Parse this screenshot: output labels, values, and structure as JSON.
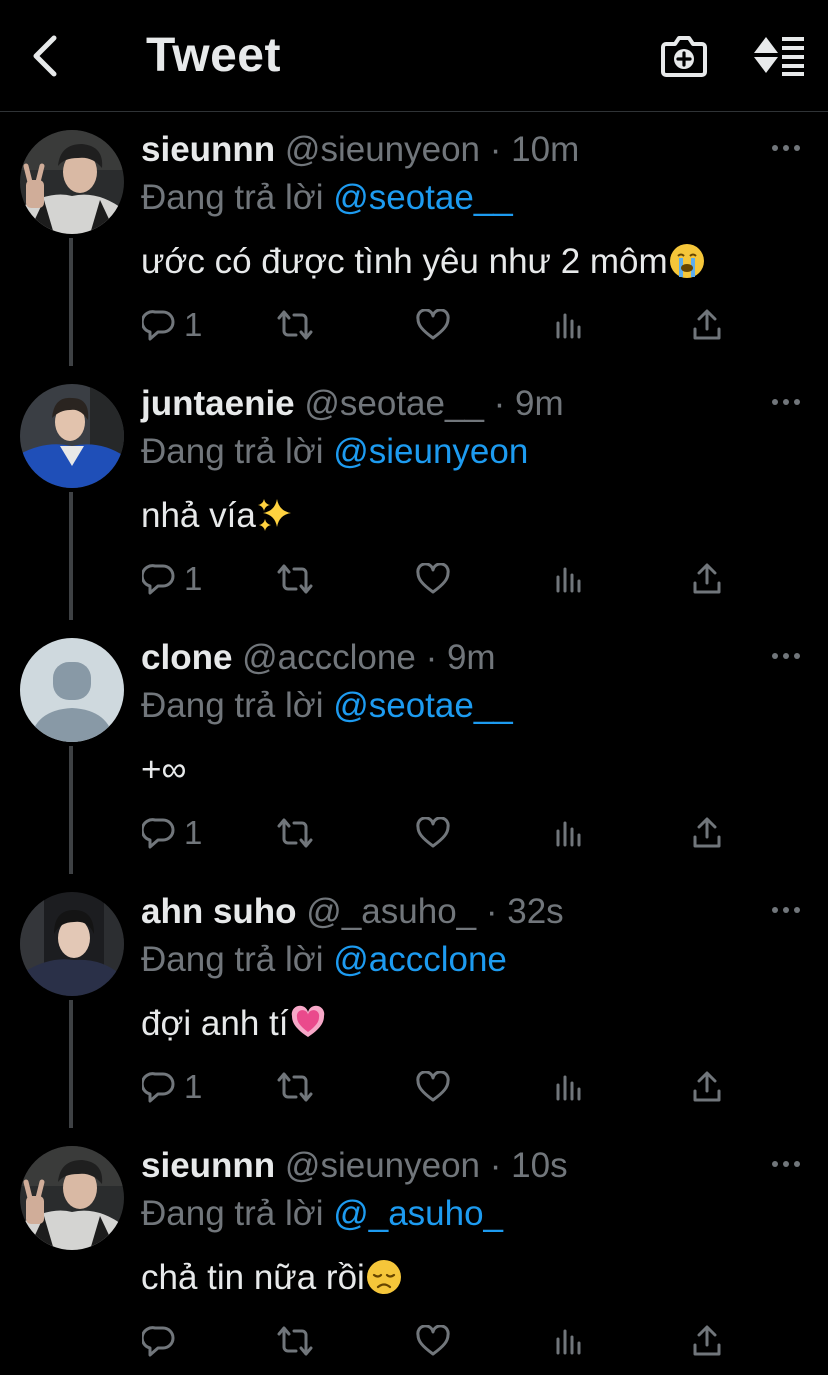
{
  "header": {
    "title": "Tweet",
    "back_icon": "chevron-left-icon",
    "camera_icon": "camera-add-icon",
    "sort_icon": "sort-icon"
  },
  "colors": {
    "background": "#000000",
    "text": "#e7e9ea",
    "muted": "#71767b",
    "mention": "#1d9bf0",
    "divider": "#2f3336",
    "thread": "#3e4144"
  },
  "reply_prefix": "Đang trả lời",
  "tweets": [
    {
      "name": "sieunnn",
      "handle": "@sieunyeon",
      "dot": "·",
      "time": "10m",
      "reply_to": "@seotae__",
      "text": "ước có được tình yêu như 2 môm",
      "emoji": "loudly-crying-face",
      "reply_count": "1",
      "avatar": "photo"
    },
    {
      "name": "juntaenie",
      "handle": "@seotae__",
      "dot": "·",
      "time": "9m",
      "reply_to": "@sieunyeon",
      "text": "nhả vía",
      "emoji": "sparkles",
      "reply_count": "1",
      "avatar": "photo"
    },
    {
      "name": "clone",
      "handle": "@accclone",
      "dot": "·",
      "time": "9m",
      "reply_to": "@seotae__",
      "text": "+∞",
      "emoji": "",
      "reply_count": "1",
      "avatar": "default"
    },
    {
      "name": "ahn suho",
      "handle": "@_asuho_",
      "dot": "·",
      "time": "32s",
      "reply_to": "@accclone",
      "text": "đợi anh tí",
      "emoji": "growing-heart",
      "reply_count": "1",
      "avatar": "photo"
    },
    {
      "name": "sieunnn",
      "handle": "@sieunyeon",
      "dot": "·",
      "time": "10s",
      "reply_to": "@_asuho_",
      "text": "chả tin nữa rồi",
      "emoji": "disappointed-face",
      "reply_count": "",
      "avatar": "photo"
    }
  ]
}
